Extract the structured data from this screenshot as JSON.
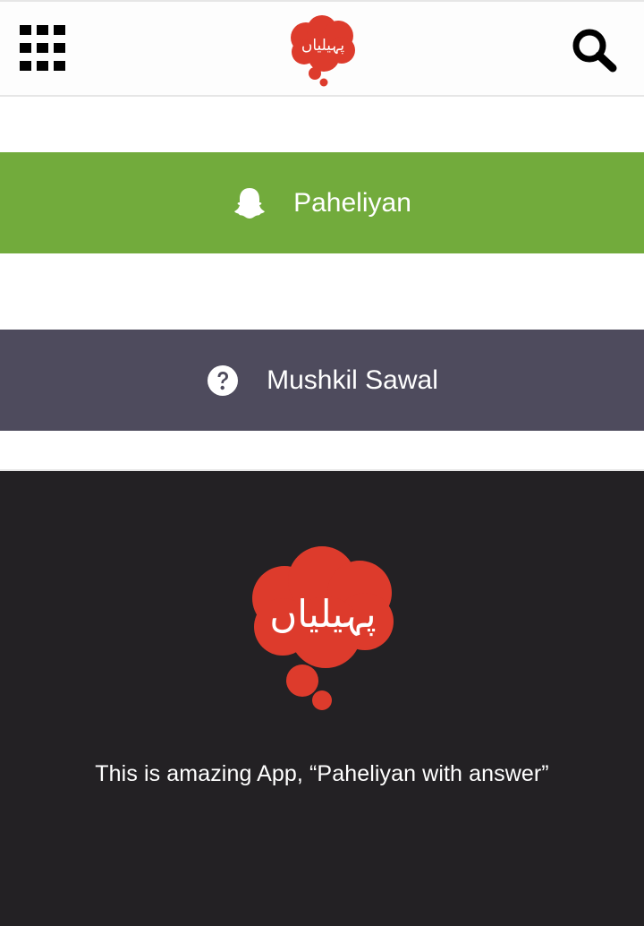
{
  "app": {
    "logo_text": "پہیلیاں"
  },
  "header": {
    "menu_icon": "grid-icon",
    "search_icon": "search-icon"
  },
  "menu": {
    "items": [
      {
        "label": "Paheliyan",
        "icon": "ghost-icon",
        "color": "#72ab3c"
      },
      {
        "label": "Mushkil Sawal",
        "icon": "question-circle-icon",
        "color": "#4e4b5d"
      }
    ]
  },
  "footer": {
    "background": "#232124",
    "tagline": "This is amazing App, “Paheliyan with answer”"
  },
  "colors": {
    "logo_red": "#dd3b2c"
  }
}
